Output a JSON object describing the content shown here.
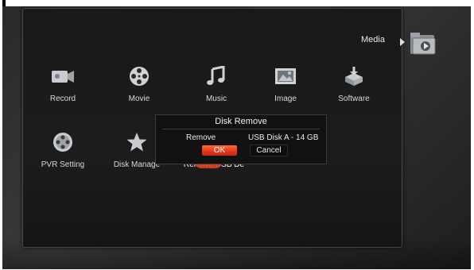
{
  "header": {
    "section_label": "Media",
    "section_icon": "media-folder-icon"
  },
  "menu": {
    "items": [
      {
        "label": "Record",
        "icon": "camera-icon"
      },
      {
        "label": "Movie",
        "icon": "film-reel-icon"
      },
      {
        "label": "Music",
        "icon": "music-note-icon"
      },
      {
        "label": "Image",
        "icon": "picture-icon"
      },
      {
        "label": "Software",
        "icon": "software-install-icon"
      },
      {
        "label": "PVR Setting",
        "icon": "pvr-reel-icon"
      },
      {
        "label": "Disk Manage",
        "icon": "star-icon"
      },
      {
        "label": "Remove USB De",
        "icon": "usb-remove-icon"
      }
    ]
  },
  "dialog": {
    "title": "Disk Remove",
    "row_label": "Remove",
    "row_value": "USB Disk A - 14 GB",
    "ok_label": "OK",
    "cancel_label": "Cancel"
  },
  "colors": {
    "accent": "#e2371a",
    "background": "#1c1c1c",
    "text": "#d8d8d8"
  }
}
